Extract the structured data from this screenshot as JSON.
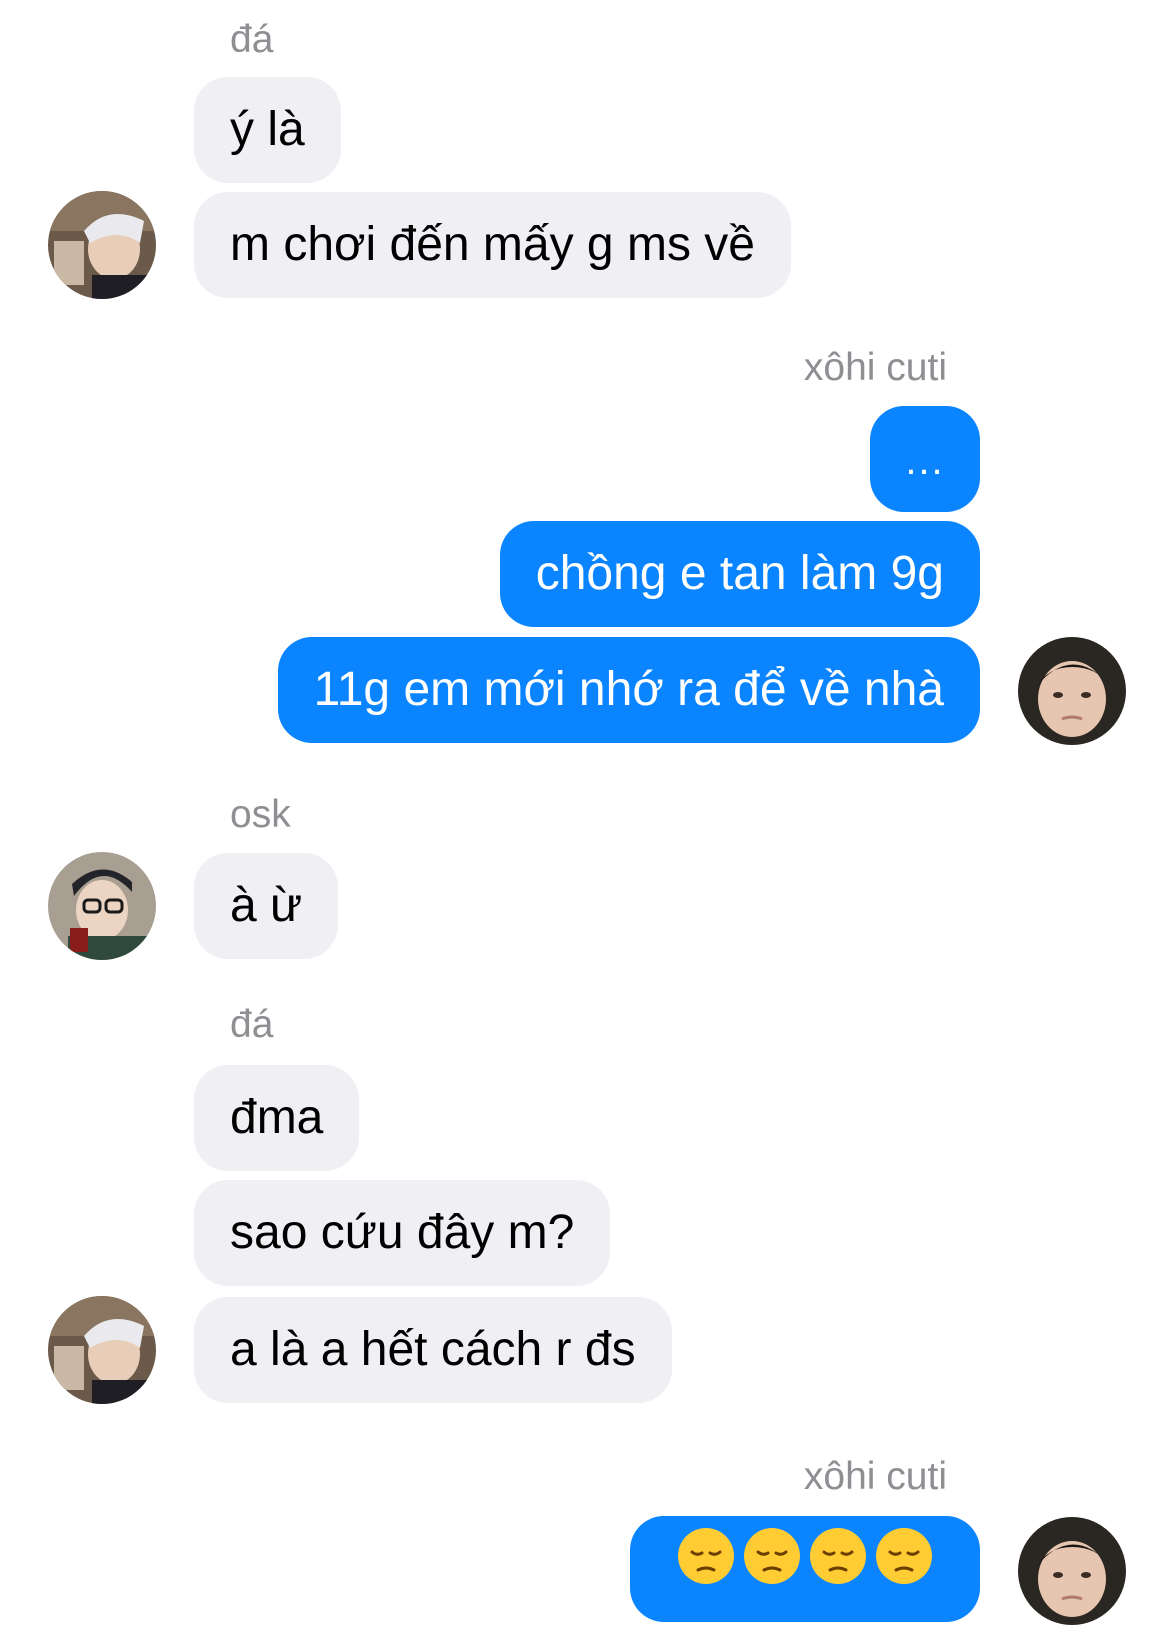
{
  "conversation": {
    "groups": [
      {
        "sender": "đá",
        "messages": [
          "ý là",
          "m chơi đến mấy g ms về"
        ]
      },
      {
        "sender": "xôhi cuti",
        "messages": [
          "...",
          "chồng e tan làm 9g",
          "11g em mới nhớ ra để về nhà"
        ]
      },
      {
        "sender": "osk",
        "messages": [
          "à ừ"
        ]
      },
      {
        "sender": "đá",
        "messages": [
          "đma",
          "sao cứu đây m?",
          "a là a hết cách r đs"
        ]
      },
      {
        "sender": "xôhi cuti",
        "messages": [
          "😔😔😔😔"
        ]
      }
    ]
  },
  "avatars": {
    "da": "avatar-da",
    "osk": "avatar-osk",
    "xohi": "avatar-xohi-cuti"
  },
  "colors": {
    "incoming_bubble": "#efeff4",
    "outgoing_bubble": "#0a84ff",
    "sender_name": "#8e8e93",
    "background": "#ffffff"
  },
  "icons": {
    "reaction_emoji": "pensive-face-icon"
  }
}
